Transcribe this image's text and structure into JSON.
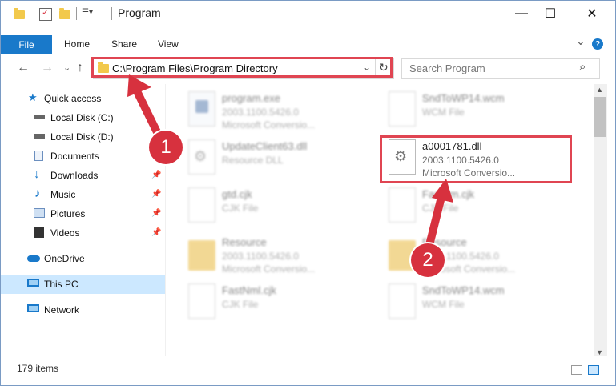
{
  "window": {
    "title": "Program",
    "controls": {
      "minimize": "—",
      "maximize": "☐",
      "close": "✕"
    }
  },
  "ribbon": {
    "tabs": [
      "File",
      "Home",
      "Share",
      "View"
    ],
    "expand_icon": "⌄",
    "help": "?"
  },
  "nav": {
    "back": "←",
    "forward": "→",
    "dropdown": "⌄",
    "up": "↑",
    "address": "C:\\Program Files\\Program Directory",
    "refresh_icon": "↻",
    "address_dropdown": "⌄",
    "search_placeholder": "Search Program",
    "search_icon": "⌕"
  },
  "sidebar": {
    "items": [
      {
        "label": "Quick access",
        "icon": "star-icon"
      },
      {
        "label": "Local Disk (C:)",
        "icon": "drive-icon"
      },
      {
        "label": "Local Disk (D:)",
        "icon": "drive-icon"
      },
      {
        "label": "Documents",
        "icon": "documents-icon",
        "pinned": true
      },
      {
        "label": "Downloads",
        "icon": "download-icon",
        "pinned": true
      },
      {
        "label": "Music",
        "icon": "music-icon",
        "pinned": true
      },
      {
        "label": "Pictures",
        "icon": "pictures-icon",
        "pinned": true
      },
      {
        "label": "Videos",
        "icon": "videos-icon",
        "pinned": true
      },
      {
        "label": "OneDrive",
        "icon": "cloud-icon"
      },
      {
        "label": "This PC",
        "icon": "computer-icon",
        "selected": true
      },
      {
        "label": "Network",
        "icon": "network-icon"
      }
    ]
  },
  "files": [
    {
      "name": "program.exe",
      "line1": "2003.1100.5426.0",
      "line2": "Microsoft Conversio...",
      "icon": "exe-icon"
    },
    {
      "name": "SndToWP14.wcm",
      "line1": "WCM File",
      "line2": "",
      "icon": "file-icon"
    },
    {
      "name": "UpdateClient63.dll",
      "line1": "Resource DLL",
      "line2": "",
      "icon": "dll-icon"
    },
    {
      "name": "a0001781.dll",
      "line1": "2003.1100.5426.0",
      "line2": "Microsoft Conversio...",
      "icon": "dll-icon",
      "highlighted": true
    },
    {
      "name": "gtd.cjk",
      "line1": "CJK File",
      "line2": "",
      "icon": "file-icon"
    },
    {
      "name": "FastNm.cjk",
      "line1": "CJK File",
      "line2": "",
      "icon": "file-icon"
    },
    {
      "name": "Resource",
      "line1": "2003.1100.5426.0",
      "line2": "Microsoft Conversio...",
      "icon": "folder-icon"
    },
    {
      "name": "Resource",
      "line1": "2003.1100.5426.0",
      "line2": "Microsoft Conversio...",
      "icon": "folder-icon"
    },
    {
      "name": "FastNml.cjk",
      "line1": "CJK File",
      "line2": "",
      "icon": "file-icon"
    },
    {
      "name": "SndToWP14.wcm",
      "line1": "WCM File",
      "line2": "",
      "icon": "file-icon"
    }
  ],
  "status": {
    "items": "179 items"
  },
  "callouts": [
    "1",
    "2"
  ],
  "colors": {
    "accent": "#1979ca",
    "highlight": "#e04552",
    "callout": "#d7313e",
    "selected": "#cce8ff"
  }
}
